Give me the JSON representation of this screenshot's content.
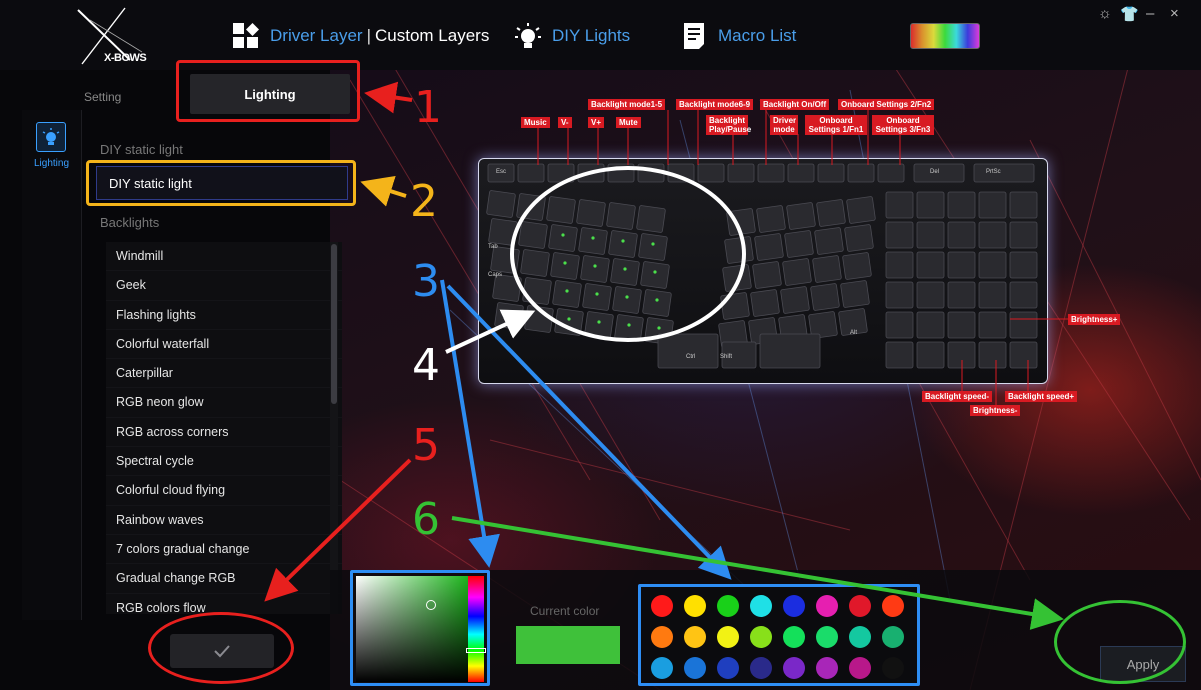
{
  "header": {
    "brand": "X-BOWS",
    "driver_layer": "Driver Layer",
    "separator": "|",
    "custom_layers": "Custom Layers",
    "diy_lights": "DIY Lights",
    "macro_list": "Macro List",
    "window_controls": {
      "settings": "☼",
      "skin": "👕",
      "minimize": "–",
      "close": "×"
    }
  },
  "rail": {
    "lighting": "Lighting"
  },
  "settings": {
    "setting_label": "Setting",
    "lighting_tab": "Lighting",
    "diy_static_title": "DIY static light",
    "diy_static_selected": "DIY static light",
    "backlights_title": "Backlights",
    "backlights": [
      "Windmill",
      "Geek",
      "Flashing lights",
      "Colorful waterfall",
      "Caterpillar",
      "RGB neon glow",
      "RGB across corners",
      "Spectral cycle",
      "Colorful cloud flying",
      "Rainbow waves",
      "7 colors gradual change",
      "Gradual change RGB",
      "RGB colors flow"
    ],
    "confirm_icon": "check-icon"
  },
  "annotations": {
    "n1": "1",
    "n2": "2",
    "n3": "3",
    "n4": "4",
    "n5": "5",
    "n6": "6",
    "colors": {
      "red": "#e8201e",
      "yellow": "#f4b41a",
      "blue": "#2d8cf0",
      "white": "#ffffff",
      "green": "#35c234"
    }
  },
  "keyboard_tags": {
    "music": "Music",
    "vol_down": "V-",
    "vol_up": "V+",
    "mute": "Mute",
    "backlight_mode_1_5": "Backlight mode1-5",
    "backlight_mode_6_9": "Backlight mode6-9",
    "backlight_play_pause": "Backlight Play/Pause",
    "backlight_on_off": "Backlight On/Off",
    "driver_mode": "Driver mode",
    "onboard_fn1": "Onboard Settings 1/Fn1",
    "onboard_fn2": "Onboard Settings 2/Fn2",
    "onboard_fn3": "Onboard Settings 3/Fn3",
    "brightness_plus": "Brightness+",
    "brightness_minus": "Brightness-",
    "speed_down": "Backlight speed-",
    "speed_up": "Backlight speed+"
  },
  "keys": {
    "esc": "Esc",
    "tab": "Tab",
    "caps": "Caps",
    "del": "Del",
    "prtsc": "PrtSc",
    "ctrl": "Ctrl",
    "shift": "Shift",
    "alt": "Alt"
  },
  "color_picker": {
    "current_color_label": "Current color",
    "current_color": "#3fc13a",
    "palette": [
      "#ff1a1a",
      "#ffe000",
      "#19d019",
      "#1fe0e6",
      "#1b2de0",
      "#e61fb0",
      "#e0182a",
      "#ff3a14",
      "#ff7a10",
      "#ffc414",
      "#f2f214",
      "#88e01a",
      "#14e05a",
      "#1adc6a",
      "#14c8a0",
      "#18b070",
      "#1a9ee0",
      "#1a74d8",
      "#1f3fbf",
      "#2a2a8a",
      "#7a28c8",
      "#a826b8",
      "#b8188a",
      "#111111"
    ]
  },
  "apply_label": "Apply"
}
